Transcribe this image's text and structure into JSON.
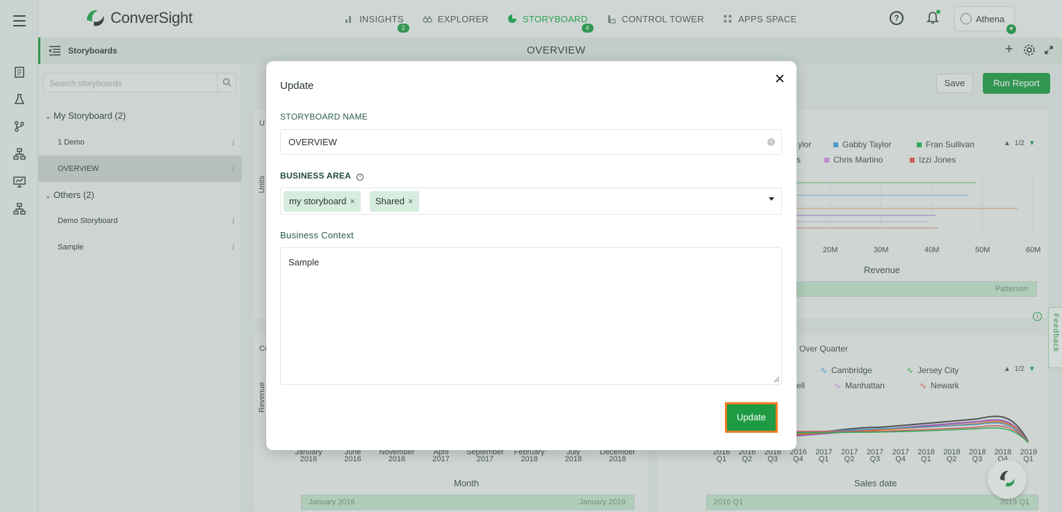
{
  "app": {
    "brand": "ConverSight",
    "nav": [
      {
        "label": "INSIGHTS",
        "badge": "2",
        "icon": "bar-chart-icon",
        "active": false
      },
      {
        "label": "EXPLORER",
        "badge": "",
        "icon": "binoculars-icon",
        "active": false
      },
      {
        "label": "STORYBOARD",
        "badge": "4",
        "icon": "pie-icon",
        "active": true
      },
      {
        "label": "CONTROL TOWER",
        "badge": "",
        "icon": "tower-icon",
        "active": false
      },
      {
        "label": "APPS SPACE",
        "badge": "",
        "icon": "grid-icon",
        "active": false
      }
    ],
    "user": "Athena",
    "accent": "#1f9b44"
  },
  "header": {
    "panel_label": "Storyboards",
    "title": "OVERVIEW"
  },
  "sidebar": {
    "search_placeholder": "Search storyboards",
    "groups": [
      {
        "label": "My Storyboard (2)",
        "items": [
          "1 Demo",
          "OVERVIEW"
        ]
      },
      {
        "label": "Others (2)",
        "items": [
          "Demo Storyboard",
          "Sample"
        ]
      }
    ],
    "edit_glyph": "i"
  },
  "toolbar": {
    "save": "Save",
    "run": "Run Report"
  },
  "background": {
    "legend_top": [
      "ylor",
      "Gabby Taylor",
      "Fran Sullivan",
      "s",
      "Chris Martino",
      "Izzi Jones"
    ],
    "legend_top_page": "1/2",
    "x_ticks_top": [
      "20M",
      "30M",
      "40M",
      "50M",
      "60M"
    ],
    "x_title_top": "Revenue",
    "slider_top_label": "Patterson",
    "left_chart_x_ticks": [
      "January 2016",
      "June 2016",
      "November 2016",
      "April 2017",
      "September 2017",
      "February 2018",
      "July 2018",
      "December 2018"
    ],
    "left_chart_x_title": "Month",
    "left_slider_start": "January 2016",
    "left_slider_end": "January 2019",
    "right_chart_title": "Over Quarter",
    "legend_bottom": [
      "Cambridge",
      "Jersey City",
      "ell",
      "Manhattan",
      "Newark"
    ],
    "legend_bottom_page": "1/2",
    "right_chart_x_ticks": [
      "2016 Q1",
      "2016 Q2",
      "2016 Q3",
      "2016 Q4",
      "2017 Q1",
      "2017 Q2",
      "2017 Q3",
      "2017 Q4",
      "2018 Q1",
      "2018 Q2",
      "2018 Q3",
      "2018 Q4",
      "2019 Q1"
    ],
    "right_chart_x_title": "Sales date",
    "right_slider_start": "2016 Q1",
    "right_slider_end": "2019 Q1",
    "y_label_partial_top": "Units",
    "y_label_partial_bottom": "Revenue",
    "left_partial_title_top": "U",
    "left_partial_title_bottom": "Co",
    "feedback": "Feedback"
  },
  "modal": {
    "title": "Update",
    "name_label": "STORYBOARD NAME",
    "name_value": "OVERVIEW",
    "area_label": "BUSINESS AREA",
    "area_chips": [
      "my storyboard",
      "Shared"
    ],
    "context_label": "Business Context",
    "context_value": "Sample",
    "submit": "Update"
  }
}
